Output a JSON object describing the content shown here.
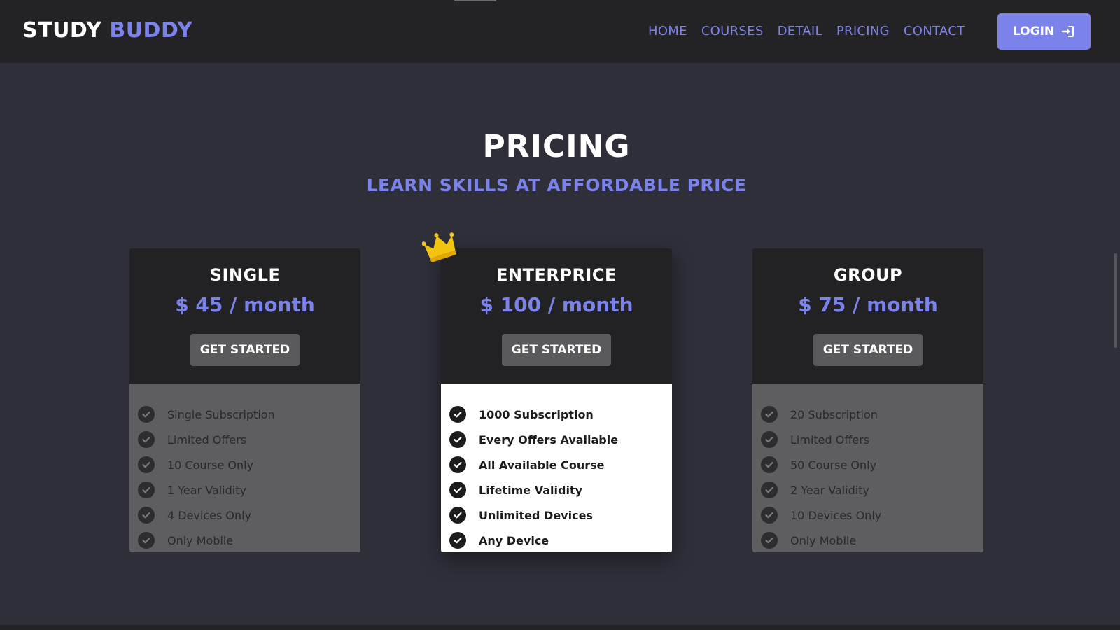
{
  "brand": {
    "word1": "STUDY",
    "word2": "BUDDY"
  },
  "nav": {
    "items": [
      "HOME",
      "COURSES",
      "DETAIL",
      "PRICING",
      "CONTACT"
    ],
    "login_label": "LOGIN"
  },
  "section": {
    "title": "PRICING",
    "subtitle": "LEARN SKILLS AT AFFORDABLE PRICE"
  },
  "plans": [
    {
      "name": "SINGLE",
      "price": "$ 45 / month",
      "button": "GET STARTED",
      "features": [
        "Single Subscription",
        "Limited Offers",
        "10 Course Only",
        "1 Year Validity",
        "4 Devices Only",
        "Only Mobile"
      ]
    },
    {
      "name": "ENTERPRICE",
      "price": "$ 100 / month",
      "button": "GET STARTED",
      "features": [
        "1000 Subscription",
        "Every Offers Available",
        "All Available Course",
        "Lifetime Validity",
        "Unlimited Devices",
        "Any Device"
      ]
    },
    {
      "name": "GROUP",
      "price": "$ 75 / month",
      "button": "GET STARTED",
      "features": [
        "20 Subscription",
        "Limited Offers",
        "50 Course Only",
        "2 Year Validity",
        "10 Devices Only",
        "Only Mobile"
      ]
    }
  ],
  "colors": {
    "accent": "#7b83eb",
    "navbar": "#232325",
    "background": "#2f2f3a",
    "crown": "#f2c40f"
  },
  "icons": {
    "login": "sign-in-icon",
    "check": "check-circle-icon",
    "featured": "crown-icon"
  }
}
